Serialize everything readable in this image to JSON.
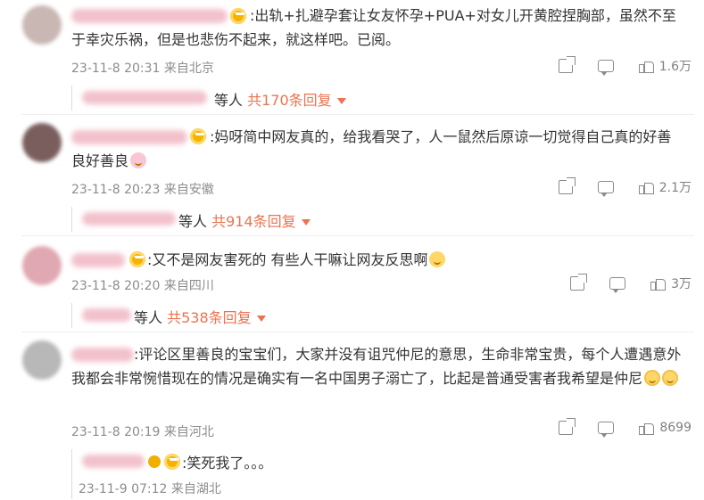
{
  "comments": [
    {
      "text": ":出轨+扎避孕套让女友怀孕+PUA+对女儿开黄腔捏胸部，虽然不至于幸灾乐祸，但是也悲伤不起来，就这样吧。已阅。",
      "time": "23-11-8 20:31",
      "location": "来自北京",
      "likes": "1.6万",
      "reply_suffix": "等人",
      "reply_count": "共170条回复",
      "avatar_color": "#c9b7b3"
    },
    {
      "text": ":妈呀简中网友真的，给我看哭了，人一鼠然后原谅一切觉得自己真的好善良好善良",
      "time": "23-11-8 20:23",
      "location": "来自安徽",
      "likes": "2.1万",
      "reply_suffix": "等人",
      "reply_count": "共914条回复",
      "avatar_color": "#7a5e5e"
    },
    {
      "text": ":又不是网友害死的 有些人干嘛让网友反思啊",
      "time": "23-11-8 20:20",
      "location": "来自四川",
      "likes": "3万",
      "reply_suffix": "等人",
      "reply_count": "共538条回复",
      "avatar_color": "#e0a8b2"
    },
    {
      "text": ":评论区里善良的宝宝们，大家并没有诅咒仲尼的意思，生命非常宝贵，每个人遭遇意外我都会非常惋惜现在的情况是确实有一名中国男子溺亡了，比起是普通受害者我希望是仲尼",
      "time": "23-11-8 20:19",
      "location": "来自河北",
      "likes": "8699",
      "avatar_color": "#b8b8b8"
    }
  ],
  "sub_reply": {
    "text": ":笑死我了。。。",
    "time": "23-11-9 07:12",
    "location": "来自湖北"
  }
}
